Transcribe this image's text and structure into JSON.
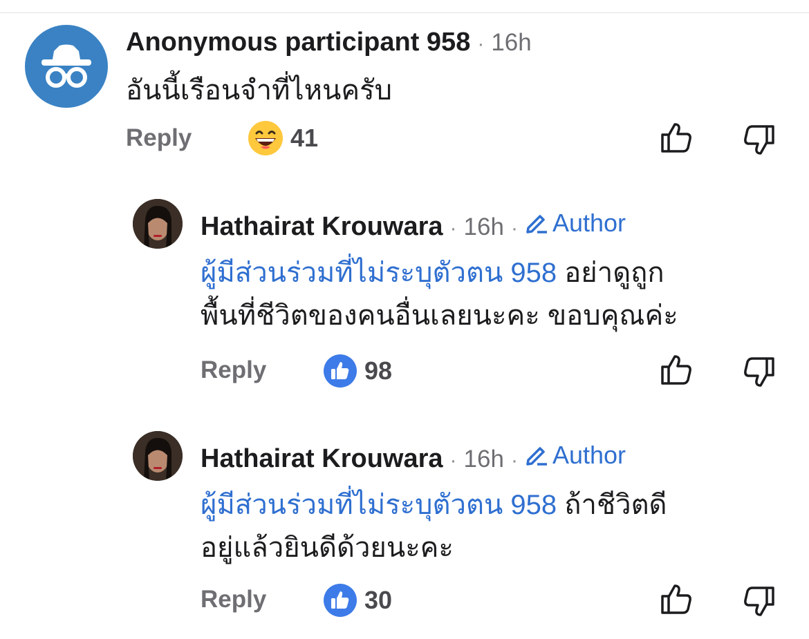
{
  "comments": [
    {
      "author": "Anonymous participant 958",
      "time": "16h",
      "text": "อันนี้เรือนจำที่ไหนครับ",
      "reply_label": "Reply",
      "reaction_icon": "laughing-emoji-icon",
      "reaction_count": "41"
    },
    {
      "author": "Hathairat Krouwara",
      "time": "16h",
      "badge": "Author",
      "mention": "ผู้มีส่วนร่วมที่ไม่ระบุตัวตน 958",
      "text_line1": "อย่าดูถูก",
      "text_line2": "พื้นที่ชีวิตของคนอื่นเลยนะคะ ขอบคุณค่ะ",
      "reply_label": "Reply",
      "reaction_icon": "like-icon",
      "reaction_count": "98"
    },
    {
      "author": "Hathairat Krouwara",
      "time": "16h",
      "badge": "Author",
      "mention": "ผู้มีส่วนร่วมที่ไม่ระบุตัวตน 958",
      "text_line1": "ถ้าชีวิตดี",
      "text_line2": "อยู่แล้วยินดีด้วยนะคะ",
      "reply_label": "Reply",
      "reaction_icon": "like-icon",
      "reaction_count": "30"
    }
  ],
  "colors": {
    "anon_avatar": "#3a82c4",
    "link": "#2f6fd0",
    "muted": "#6e6e73",
    "like_badge": "#3d7be8"
  }
}
